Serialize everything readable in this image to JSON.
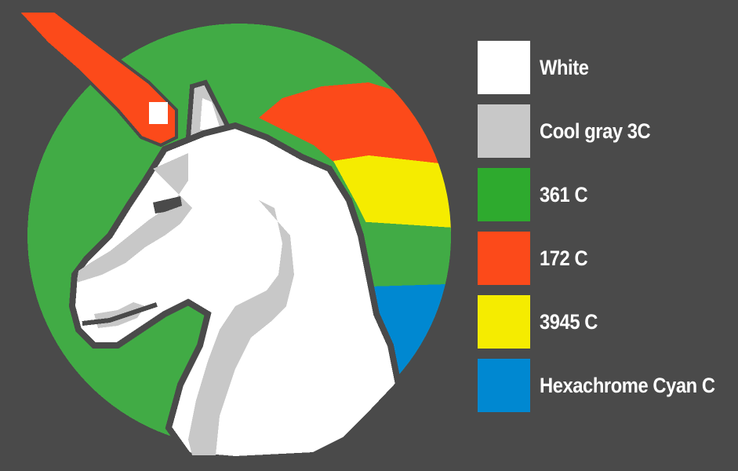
{
  "legend": {
    "items": [
      {
        "label": "White",
        "color": "#ffffff"
      },
      {
        "label": "Cool gray 3C",
        "color": "#c8c8c8"
      },
      {
        "label": "361 C",
        "color": "#2eaa2e"
      },
      {
        "label": "172 C",
        "color": "#fc4a1a"
      },
      {
        "label": "3945 C",
        "color": "#f5ec00"
      },
      {
        "label": "Hexachrome Cyan C",
        "color": "#0088d1"
      }
    ]
  },
  "artwork": {
    "subject-icon": "unicorn-icon",
    "background_color": "#4a4a4a",
    "outline_color": "#4a4a4a"
  }
}
